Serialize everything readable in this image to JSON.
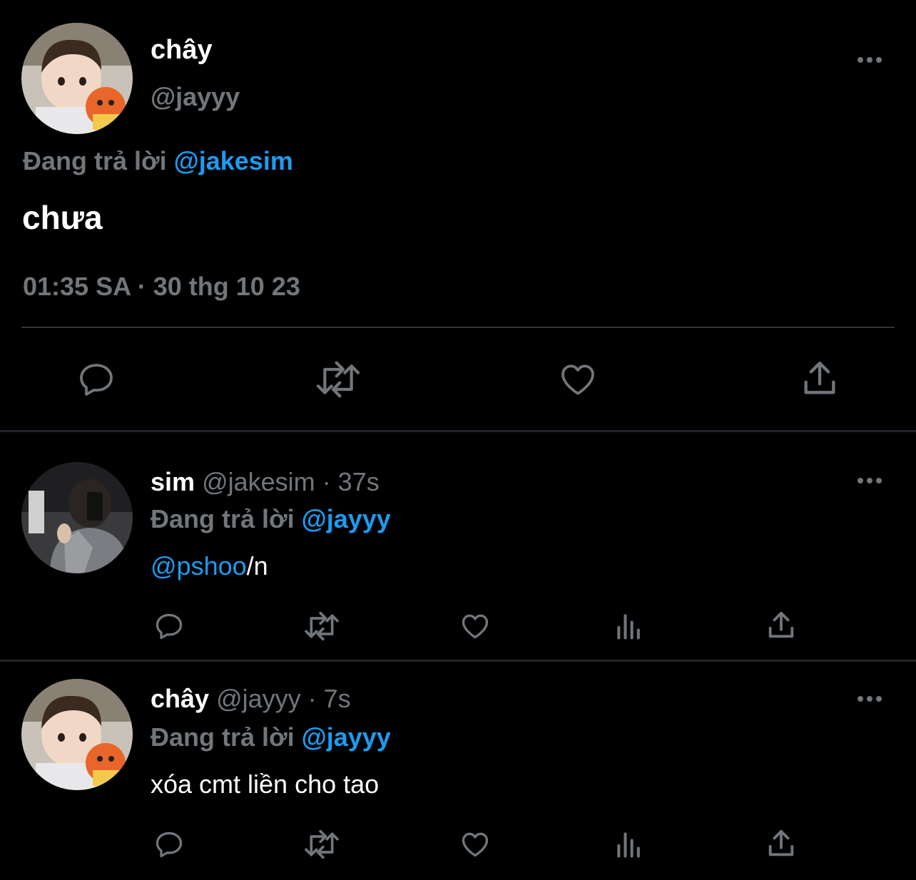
{
  "main_tweet": {
    "display_name": "chây",
    "handle": "@jayyy",
    "replying_prefix": "Đang trả lời",
    "replying_to": "@jakesim",
    "text": "chưa",
    "timestamp": "01:35 SA · 30 thg 10 23"
  },
  "replies": [
    {
      "display_name": "sim",
      "handle": "@jakesim",
      "time": "· 37s",
      "replying_prefix": "Đang trả lời",
      "replying_to": "@jayyy",
      "mention": "@pshoo",
      "text_rest": "/n"
    },
    {
      "display_name": "chây",
      "handle": "@jayyy",
      "time": "· 7s",
      "replying_prefix": "Đang trả lời",
      "replying_to": "@jayyy",
      "text": "xóa cmt liền cho tao"
    }
  ],
  "colors": {
    "background": "#000000",
    "muted": "#71767b",
    "link": "#1d9bf0"
  },
  "icons": [
    "reply-icon",
    "retweet-icon",
    "like-icon",
    "views-icon",
    "share-icon",
    "more-icon"
  ]
}
